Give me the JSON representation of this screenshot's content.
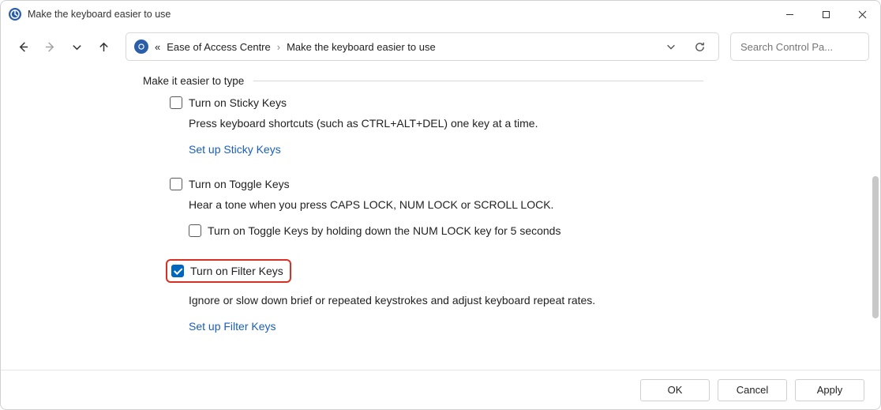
{
  "window": {
    "title": "Make the keyboard easier to use"
  },
  "breadcrumb": {
    "prefix": "«",
    "parent": "Ease of Access Centre",
    "current": "Make the keyboard easier to use"
  },
  "search": {
    "placeholder": "Search Control Pa..."
  },
  "section": {
    "heading": "Make it easier to type"
  },
  "sticky": {
    "checkbox_label": "Turn on Sticky Keys",
    "checked": false,
    "description": "Press keyboard shortcuts (such as CTRL+ALT+DEL) one key at a time.",
    "link": "Set up Sticky Keys"
  },
  "toggle": {
    "checkbox_label": "Turn on Toggle Keys",
    "checked": false,
    "description": "Hear a tone when you press CAPS LOCK, NUM LOCK or SCROLL LOCK.",
    "sub_checkbox_label": "Turn on Toggle Keys by holding down the NUM LOCK key for 5 seconds",
    "sub_checked": false
  },
  "filter": {
    "checkbox_label": "Turn on Filter Keys",
    "checked": true,
    "highlighted": true,
    "description": "Ignore or slow down brief or repeated keystrokes and adjust keyboard repeat rates.",
    "link": "Set up Filter Keys"
  },
  "buttons": {
    "ok": "OK",
    "cancel": "Cancel",
    "apply": "Apply"
  }
}
